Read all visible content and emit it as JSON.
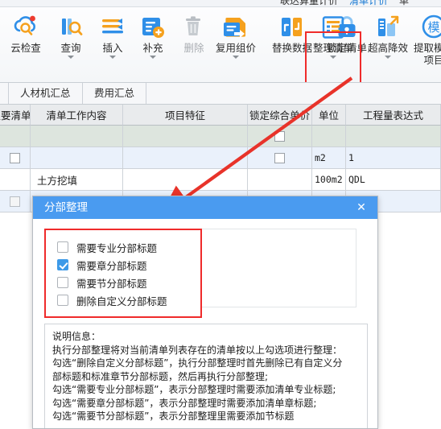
{
  "window": {
    "top_tabs": [
      "联达算量计价",
      "清单计价",
      "单"
    ],
    "top_tab_selected": "清单计价"
  },
  "ribbon": {
    "buttons": [
      {
        "label": "云检查",
        "icon": "cloud-search-icon",
        "caret": false,
        "disabled": false
      },
      {
        "label": "查询",
        "icon": "book-search-icon",
        "caret": true,
        "disabled": false
      },
      {
        "label": "插入",
        "icon": "insert-rows-icon",
        "caret": true,
        "disabled": false
      },
      {
        "label": "补充",
        "icon": "add-document-icon",
        "caret": true,
        "disabled": false
      },
      {
        "label": "删除",
        "icon": "trash-icon",
        "caret": false,
        "disabled": true
      },
      {
        "label": "复用组价",
        "icon": "reuse-price-icon",
        "caret": true,
        "disabled": false
      },
      {
        "label": "替换数据",
        "icon": "swap-data-icon",
        "caret": false,
        "disabled": false
      },
      {
        "label": "锁定清单",
        "icon": "lock-icon",
        "caret": false,
        "disabled": false
      },
      {
        "label": "整理清单",
        "icon": "organize-list-icon",
        "caret": true,
        "disabled": false
      },
      {
        "label": "超高降效",
        "icon": "height-efficiency-icon",
        "caret": true,
        "disabled": false
      },
      {
        "label": "提取模板项目",
        "icon": "extract-template-icon",
        "caret": false,
        "disabled": false
      }
    ],
    "highlighted_button": "整理清单",
    "highlight_color": "#ef2b2b"
  },
  "subtabs": {
    "items": [
      "人材机汇总",
      "费用汇总"
    ]
  },
  "grid": {
    "columns": [
      "主要清单",
      "清单工作内容",
      "项目特征",
      "锁定综合单价",
      "单位",
      "工程量表达式"
    ],
    "rows": [
      {
        "style": "rowA",
        "check1": "",
        "work": "",
        "feature": "",
        "lock": "unchecked",
        "unit": "",
        "expr": ""
      },
      {
        "style": "rowB",
        "check1": "unchecked",
        "work": "",
        "feature": "",
        "lock": "unchecked",
        "unit": "m2",
        "expr": "1"
      },
      {
        "style": "rowC",
        "check1": "",
        "work": "土方挖填",
        "feature": "",
        "lock": "",
        "unit": "100m2",
        "expr": "QDL"
      },
      {
        "style": "rowB",
        "check1": "unchecked",
        "work": "",
        "feature": "",
        "lock": "unchecked",
        "unit": "",
        "expr": ""
      }
    ]
  },
  "dialog": {
    "title": "分部整理",
    "close_label": "✕",
    "header_color": "#4a9bf0",
    "options": [
      {
        "label": "需要专业分部标题",
        "checked": false
      },
      {
        "label": "需要章分部标题",
        "checked": true
      },
      {
        "label": "需要节分部标题",
        "checked": false
      },
      {
        "label": "删除自定义分部标题",
        "checked": false
      }
    ],
    "description": [
      "说明信息：",
      "执行分部整理将对当前清单列表存在的清单按以上勾选项进行整理：",
      "勾选“删除自定义分部标题”，执行分部整理时首先删除已有自定义分",
      "部标题和标准章节分部标题，然后再执行分部整理;",
      "勾选“需要专业分部标题”，表示分部整理时需要添加清单专业标题;",
      "勾选“需要章分部标题”，表示分部整理时需要添加清单章标题;",
      "勾选“需要节分部标题”，表示分部整理里需要添加节标题"
    ]
  },
  "annotations": {
    "arrow_color": "#e8332a",
    "arrow_from": "整理清单",
    "arrow_to": "分部整理"
  }
}
